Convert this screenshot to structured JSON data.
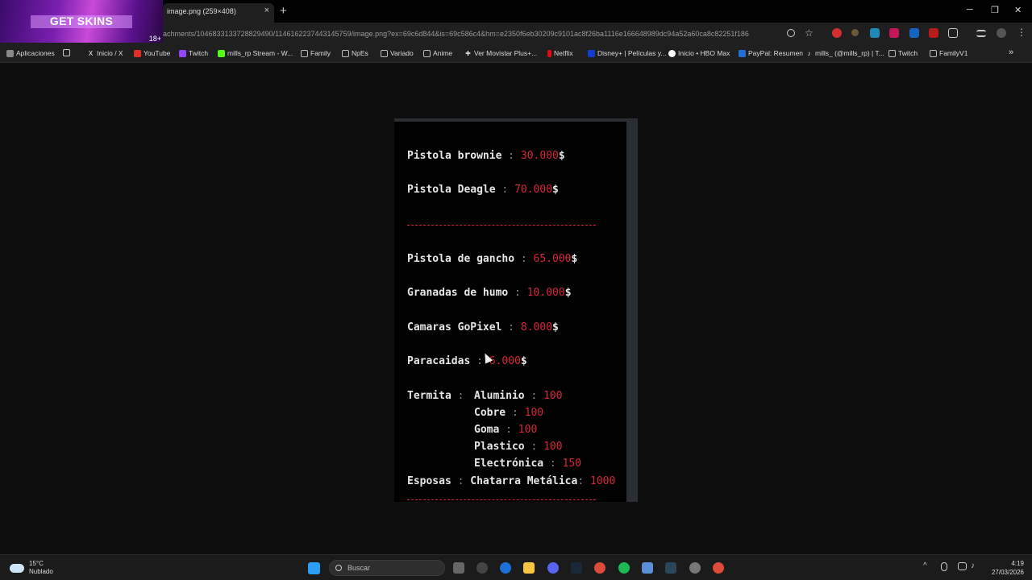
{
  "promo": {
    "text": "GET SKINS",
    "age": "18+"
  },
  "tab": {
    "title": "image.png (259×408)",
    "close": "×",
    "new": "+"
  },
  "window": {
    "minimize": "─",
    "restore": "❐",
    "close": "✕"
  },
  "url": "achments/1046833133728829490/1146162237443145759/image.png?ex=69c6d844&is=69c586c4&hm=e2350f6eb30209c9101ac8f26ba1116e166648989dc94a52a60ca8c82251f186",
  "bookmarks": [
    {
      "label": "Aplicaciones"
    },
    {
      "label": "Inicio / X"
    },
    {
      "label": "YouTube"
    },
    {
      "label": "Twitch"
    },
    {
      "label": "mills_rp Stream - W..."
    },
    {
      "label": "Family"
    },
    {
      "label": "NpEs"
    },
    {
      "label": "Variado"
    },
    {
      "label": "Anime"
    },
    {
      "label": "Ver Movistar Plus+..."
    },
    {
      "label": "Netflix"
    },
    {
      "label": "Disney+ | Películas y..."
    },
    {
      "label": "Inicio • HBO Max"
    },
    {
      "label": "PayPal: Resumen"
    },
    {
      "label": "mills_ (@mills_rp) | T..."
    },
    {
      "label": "Twitch"
    },
    {
      "label": "FamilyV1"
    }
  ],
  "doc": {
    "items": [
      {
        "name": "Pistola brownie",
        "sep": " : ",
        "value": "30.000",
        "unit": "$"
      },
      {
        "name": "Pistola Deagle",
        "sep": " : ",
        "value": "70.000",
        "unit": "$"
      },
      {
        "name": "Pistola de gancho",
        "sep": " : ",
        "value": "65.000",
        "unit": "$"
      },
      {
        "name": "Granadas de humo",
        "sep": " : ",
        "value": "10.000",
        "unit": "$"
      },
      {
        "name": "Camaras GoPixel",
        "sep": " : ",
        "value": "8.000",
        "unit": "$"
      },
      {
        "name": "Paracaidas",
        "sep": " : ",
        "value": "6.000",
        "unit": "$"
      }
    ],
    "termita": {
      "label": "Termita",
      "colon": " : ",
      "rows": [
        {
          "name": "Aluminio",
          "sep": " : ",
          "value": "100"
        },
        {
          "name": "Cobre",
          "sep": " : ",
          "value": "100"
        },
        {
          "name": "Goma",
          "sep": " : ",
          "value": "100"
        },
        {
          "name": "Plastico",
          "sep": " : ",
          "value": "100"
        },
        {
          "name": "Electrónica",
          "sep": " : ",
          "value": "150"
        }
      ]
    },
    "esposas": {
      "label": "Esposas",
      "colon": " : ",
      "name": "Chatarra Metálica",
      "sep": ": ",
      "value": "1000"
    }
  },
  "taskbar": {
    "weather": {
      "temp": "15°C",
      "desc": "Nublado"
    },
    "search": "Buscar",
    "time": "4:19",
    "date": "27/03/2026"
  },
  "colors": {
    "price": "#d9263a",
    "background": "#0e0e0e",
    "doc": "#000000"
  }
}
